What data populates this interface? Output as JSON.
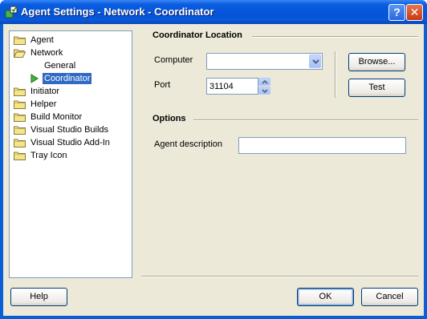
{
  "window": {
    "title": "Agent Settings - Network - Coordinator",
    "help_glyph": "?",
    "close_glyph": "✕"
  },
  "tree": {
    "items": [
      {
        "label": "Agent",
        "icon": "folder-icon"
      },
      {
        "label": "Network",
        "icon": "folder-icon"
      },
      {
        "label": "General",
        "icon": ""
      },
      {
        "label": "Coordinator",
        "icon": "arrow-right-icon",
        "selected": true
      },
      {
        "label": "Initiator",
        "icon": "folder-icon"
      },
      {
        "label": "Helper",
        "icon": "folder-icon"
      },
      {
        "label": "Build Monitor",
        "icon": "folder-icon"
      },
      {
        "label": "Visual Studio Builds",
        "icon": "folder-icon"
      },
      {
        "label": "Visual Studio Add-In",
        "icon": "folder-icon"
      },
      {
        "label": "Tray Icon",
        "icon": "folder-icon"
      }
    ]
  },
  "coordinator_location": {
    "title": "Coordinator Location",
    "computer_label": "Computer",
    "computer_value": "",
    "port_label": "Port",
    "port_value": "31104",
    "browse_label": "Browse...",
    "test_label": "Test"
  },
  "options": {
    "title": "Options",
    "agent_description_label": "Agent description",
    "agent_description_value": ""
  },
  "footer": {
    "help_label": "Help",
    "ok_label": "OK",
    "cancel_label": "Cancel"
  },
  "colors": {
    "titlebar": "#0553d8",
    "dialog_bg": "#ece9d8",
    "selection": "#316ac5"
  }
}
